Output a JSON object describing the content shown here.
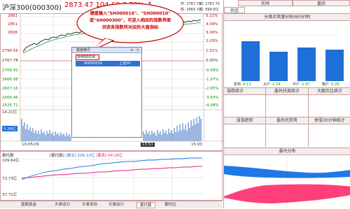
{
  "header": {
    "index_name": "沪深300(000300)",
    "price": "2873.47",
    "change": "104.68",
    "change_pct": "3.78%",
    "arrow": "↑",
    "open_label": "开:",
    "open": "2787.75",
    "high_label": "高:",
    "high": "2787.75",
    "low_label": "低:",
    "low": "2866.37",
    "amount_label": "额:",
    "amount": "899.6亿",
    "close_label": "收:",
    "close": "2866.37"
  },
  "callout": {
    "line1": "键盘输入\"SH000016\"、\"SH000010\"",
    "line2": "或\"SH000300\"，可进入相应的指数界面",
    "line3": "浏览各指数所对应的大盘指标"
  },
  "popup": {
    "title": "键盘精灵",
    "pin": "⇲",
    "close": "×",
    "input": "SH000016",
    "result_code": "SH000016",
    "result_name": "上证50"
  },
  "chart": {
    "left_axis": [
      "2891",
      "2851",
      "2836",
      "2796.56",
      "2767.78",
      "2706.91",
      "2666.08",
      "2607.16",
      "2565.46",
      "2525.71"
    ],
    "right_axis_red": [
      "5.11%",
      "4.09%",
      "3.06%",
      "2.03%",
      "1.01%"
    ],
    "right_axis_zero": "0.00%",
    "right_axis_green": [
      "-0.99%",
      "-1.97%",
      "-2.95%",
      "-3.93%",
      "-4.08%"
    ],
    "volume_labels": [
      "14.21亿",
      "5.26亿"
    ],
    "time_labels": [
      "10:05/29",
      "13:51",
      "15:00"
    ],
    "lower_left": [
      "109.64亿",
      "73.73亿",
      "37.71亿"
    ],
    "lower_legend": [
      "[委托额]",
      "(委买) 106.10亿",
      "(委卖) 64.26亿"
    ],
    "lower_title": "委托额"
  },
  "bottom_tabs": [
    "盘面资金",
    "大单动力",
    "大单流向",
    "大单动力",
    "委托额",
    "委托比"
  ],
  "right_panel": {
    "tabs": [
      "实时",
      "盘后"
    ],
    "state_tab": "状态",
    "section_title": "分类买卖量分析[60分钟]",
    "bars": [
      {
        "label": "机构",
        "value": "-0.13",
        "height": 0.82
      },
      {
        "label": "大户",
        "value": "-2.24",
        "height": 0.6
      },
      {
        "label": "中户",
        "value": "-1.97",
        "height": 0.68
      },
      {
        "label": "散户",
        "value": "-0.26",
        "height": 0.65
      }
    ],
    "grid_titles_row1": [
      "涨跌统计",
      "委托托架统计",
      "大额次比统计"
    ],
    "grid_titles_row2": [
      "涨涨趋势",
      "委托托势势",
      "拼涨30分钟统计"
    ],
    "bottom_title": "委托分布"
  },
  "colors": {
    "up": "#c00000",
    "down": "#009900",
    "accent_blue": "#1e78e8",
    "pink": "#e0207a",
    "bar_blue": "#1e6fd8"
  }
}
